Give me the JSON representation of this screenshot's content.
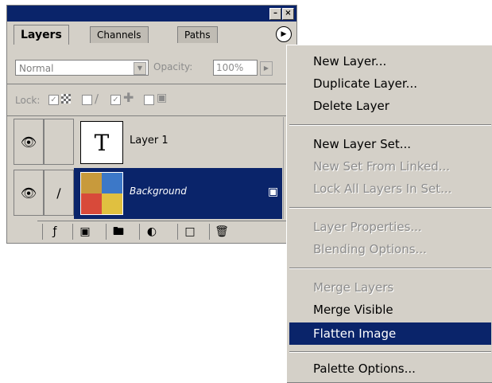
{
  "palette": {
    "tabs": [
      "Layers",
      "Channels",
      "Paths"
    ],
    "blend_mode": "Normal",
    "opacity_label": "Opacity:",
    "opacity_value": "100%",
    "lock_label": "Lock:",
    "layers": [
      {
        "name": "Layer 1",
        "thumb_glyph": "T"
      },
      {
        "name": "Background"
      }
    ]
  },
  "menu": {
    "items": [
      {
        "label": "New Layer...",
        "enabled": true
      },
      {
        "label": "Duplicate Layer...",
        "enabled": true
      },
      {
        "label": "Delete Layer",
        "enabled": true
      },
      {
        "label": "New Layer Set...",
        "enabled": true
      },
      {
        "label": "New Set From Linked...",
        "enabled": false
      },
      {
        "label": "Lock All Layers In Set...",
        "enabled": false
      },
      {
        "label": "Layer Properties...",
        "enabled": false
      },
      {
        "label": "Blending Options...",
        "enabled": false
      },
      {
        "label": "Merge Layers",
        "enabled": false
      },
      {
        "label": "Merge Visible",
        "enabled": true
      },
      {
        "label": "Flatten Image",
        "enabled": true,
        "highlighted": true
      },
      {
        "label": "Palette Options...",
        "enabled": true
      }
    ]
  },
  "colors": {
    "selection": "#0a246a",
    "panel": "#d4d0c8"
  }
}
